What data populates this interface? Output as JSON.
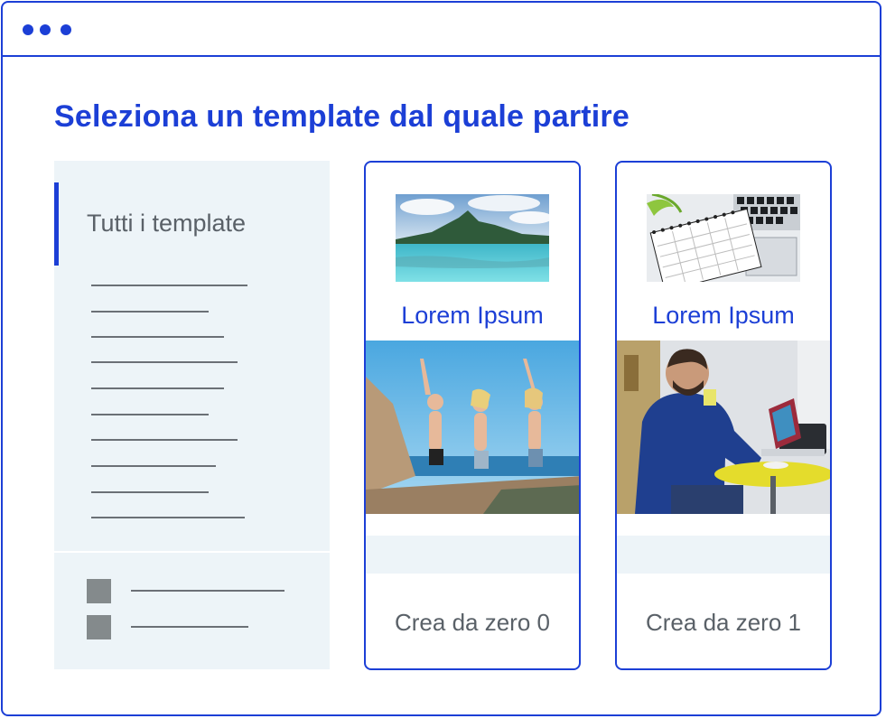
{
  "window": {
    "controls": [
      "dot",
      "dot",
      "dot"
    ]
  },
  "page": {
    "title": "Seleziona un template dal quale partire"
  },
  "sidebar": {
    "selected_label": "Tutti i template",
    "placeholder_lines": 10,
    "footer_items": 2
  },
  "cards": [
    {
      "name": "Lorem Ipsum",
      "cta": "Crea da zero 0",
      "thumb_icon": "tropical-island-image",
      "photo_icon": "friends-jumping-beach-image"
    },
    {
      "name": "Lorem Ipsum",
      "cta": "Crea da zero 1",
      "thumb_icon": "planner-keyboard-image",
      "photo_icon": "man-reading-coffee-image"
    }
  ],
  "colors": {
    "accent": "#1c3fd6",
    "panel": "#edf4f8",
    "text_muted": "#5a6168",
    "line": "#6b7076"
  }
}
